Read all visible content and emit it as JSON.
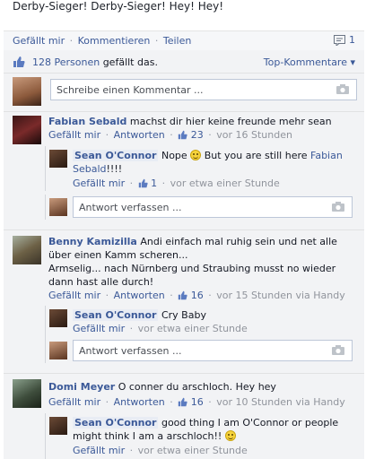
{
  "post": {
    "text": "Derby-Sieger! Derby-Sieger! Hey! Hey!"
  },
  "actions": {
    "like": "Gefällt mir",
    "comment": "Kommentieren",
    "share": "Teilen",
    "comment_count": "1"
  },
  "likes": {
    "count_link": "128 Personen",
    "suffix": "gefällt das.",
    "sort": "Top-Kommentare ▾"
  },
  "compose": {
    "placeholder": "Schreibe einen Kommentar ..."
  },
  "reply_placeholder": "Antwort verfassen ...",
  "comments": [
    {
      "name": "Fabian Sebald",
      "text": "machst dir hier keine freunde mehr sean",
      "like": "Gefällt mir",
      "reply": "Antworten",
      "likes": "23",
      "time": "vor 16 Stunden",
      "replies": [
        {
          "name": "Sean O'Connor",
          "text_before": "Nope",
          "text_after": "But you are still here",
          "mention": "Fabian Sebald",
          "text_end": "!!!!",
          "like": "Gefällt mir",
          "likes": "1",
          "time": "vor etwa einer Stunde"
        }
      ]
    },
    {
      "name": "Benny Kamizilla",
      "text": "Andi einfach mal ruhig sein und net alle über einen Kamm scheren...",
      "text2": "Armselig... nach Nürnberg und Straubing musst no wieder dann hast alle durch!",
      "like": "Gefällt mir",
      "reply": "Antworten",
      "likes": "16",
      "time": "vor 15 Stunden via Handy",
      "replies": [
        {
          "name": "Sean O'Connor",
          "text": "Cry Baby",
          "like": "Gefällt mir",
          "time": "vor etwa einer Stunde"
        }
      ]
    },
    {
      "name": "Domi Meyer",
      "text": "O conner du arschloch. Hey hey",
      "like": "Gefällt mir",
      "reply": "Antworten",
      "likes": "16",
      "time": "vor 10 Stunden via Handy",
      "replies": [
        {
          "name": "Sean O'Connor",
          "text": "good thing I am O'Connor or people might think I am a arschloch!!",
          "like": "Gefällt mir",
          "time": "vor etwa einer Stunde"
        }
      ]
    }
  ],
  "colors": {
    "link": "#3b5998",
    "ufi_bg": "#f2f3f5",
    "meta": "#90949c"
  },
  "icons": [
    "comment-bubble-icon",
    "thumbs-up-icon",
    "camera-icon",
    "smiley-icon"
  ]
}
